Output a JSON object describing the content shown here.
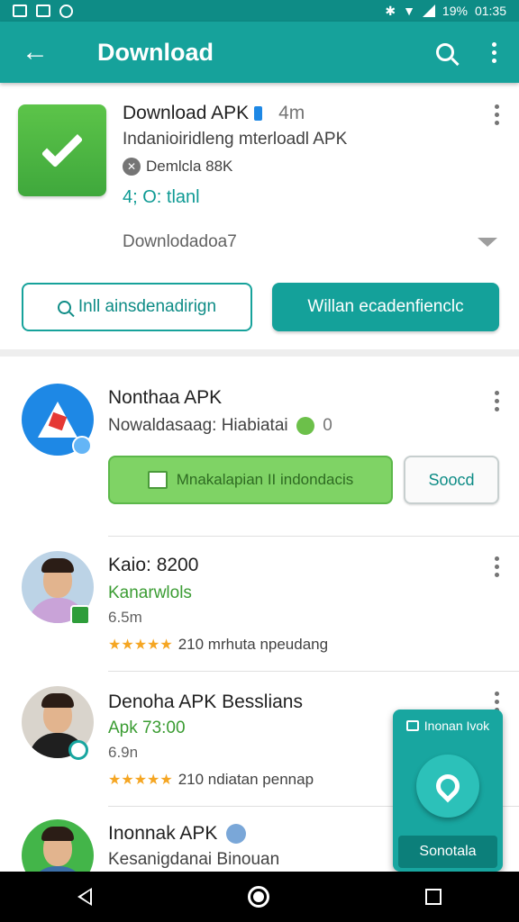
{
  "status_bar": {
    "battery": "19%",
    "time": "01:35",
    "signal_glyph": "1ð"
  },
  "app_bar": {
    "title": "Download",
    "back_icon": "arrow-left-icon",
    "search_icon": "search-icon",
    "more_icon": "more-vert-icon"
  },
  "top_card": {
    "title": "Download APK",
    "time": "4m",
    "subtitle": "Indanioiridleng mterloadl APK",
    "meta": "Deml­cla 88K",
    "link": "4; O: tlanl",
    "collapsed": "Downlodadoa7",
    "btn_outline": "Inll ainsdenadirign",
    "btn_filled": "Willan ecadenfienclc"
  },
  "rows": [
    {
      "title": "Nonthaa APK",
      "subtitle": "Nowaldasaag: Hiabiatai",
      "count": "0",
      "btn_primary": "Mnakalapian II indondacis",
      "btn_secondary": "Soocd"
    },
    {
      "title": "Kaio: 8200",
      "green": "Kanarwlols",
      "size": "6.5m",
      "rating_text": "210 mrhuta npeudang",
      "stars": "★★★★★"
    },
    {
      "title": "Denoha APK Besslians",
      "green": "Apk 73:00",
      "size": "6.9n",
      "rating_text": "210 ndiatan pennap",
      "stars": "★★★★★"
    },
    {
      "title": "Inonnak APK",
      "subtitle": "Kesanigdanai Binouan"
    }
  ],
  "float_card": {
    "header": "Inonan Ivok",
    "button": "Sonotala"
  },
  "colors": {
    "teal": "#16a29b",
    "teal_dark": "#0e8c86",
    "green": "#5cc449",
    "star": "#f5a623"
  }
}
